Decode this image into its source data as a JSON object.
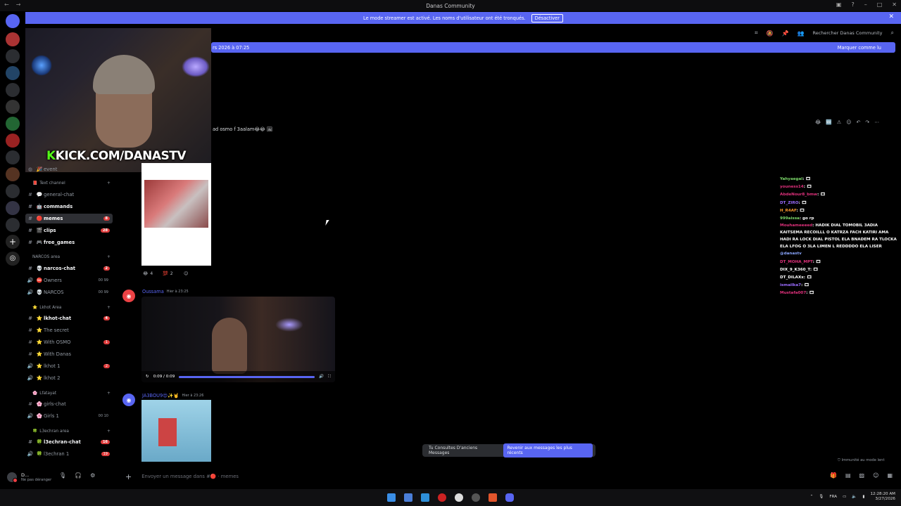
{
  "window": {
    "title": "Danas Community"
  },
  "banner": {
    "text": "Le mode streamer est activé. Les noms d'utilisateur ont été tronqués.",
    "button": "Désactiver"
  },
  "header": {
    "search_placeholder": "Rechercher Danas Community"
  },
  "new_messages_bar": {
    "date_text": "rs 2026 à 07:25",
    "mark_read": "Marquer comme lu"
  },
  "stream_overlay": {
    "kick_text": "KICK.COM/DANASTV"
  },
  "sidebar": {
    "event_item": "event",
    "categories": [
      {
        "label": "Text channel"
      },
      {
        "label": "NARCOS area"
      },
      {
        "label": "Lkhot Area"
      },
      {
        "label": "Lfatayat"
      },
      {
        "label": "L3echran area"
      }
    ],
    "channels": [
      {
        "name": "general-chat"
      },
      {
        "name": "commands"
      },
      {
        "name": "memes",
        "count": "8"
      },
      {
        "name": "clips",
        "count": "28"
      },
      {
        "name": "free_games"
      },
      {
        "name": "narcos-chat",
        "count": "2"
      },
      {
        "name": "Owners",
        "voice": "00  99"
      },
      {
        "name": "NARCOS",
        "voice": "00  99"
      },
      {
        "name": "lkhot-chat",
        "count": "4"
      },
      {
        "name": "The secret"
      },
      {
        "name": "With OSMO",
        "count": "1"
      },
      {
        "name": "With Danas"
      },
      {
        "name": "lkhot 1",
        "count": "2"
      },
      {
        "name": "lkhot 2"
      },
      {
        "name": "girls-chat"
      },
      {
        "name": "Girls 1",
        "voice": "00  10"
      },
      {
        "name": "l3echran-chat",
        "count": "16"
      },
      {
        "name": "l3echran 1",
        "count": "19"
      }
    ]
  },
  "user_panel": {
    "name": "D...",
    "status": "Ne pas déranger"
  },
  "messages": {
    "first_text": "ad osmo f 3aalam😂😂 🖼",
    "reactions": [
      {
        "emoji": "😂",
        "count": "4"
      },
      {
        "emoji": "💯",
        "count": "2"
      }
    ],
    "second_author": "Oussama",
    "second_time": "Hier à 23:25",
    "video": {
      "time": "0:09 / 0:09",
      "progress": 1.0
    },
    "third_author": "JA3BOU9😍✨🤘",
    "third_time": "Hier à 23:26"
  },
  "stream_chat": [
    {
      "user": "Yahyaegal",
      "text": ": 🎞",
      "color": "#7cd86a"
    },
    {
      "user": "youness14",
      "text": ": 🎞",
      "color": "#e0317c"
    },
    {
      "user": "AbdeNour8_bmw",
      "text": ": 🎞",
      "color": "#e0317c"
    },
    {
      "user": "DT_ZIRO",
      "text": ": 🎞",
      "color": "#9b6cff"
    },
    {
      "user": "H_R4AF",
      "text": ": 🎞",
      "color": "#ff9b2e"
    },
    {
      "user": "999aissa",
      "text": ": go rp",
      "color": "#7cd86a"
    },
    {
      "user": "Mouhameeeed",
      "text": ": HADIK DIAL TOMOBIL 3ADIA KAITSEMA RECOILLL O KATRZA FACH KATIRI AMA HADI RA LOCK DIAL PISTOL ELA BNADEM RA TLOCKA ELA LFOG O 3LA LIMEN L REDDDDO ELA LISER",
      "color": "#e0317c"
    },
    {
      "user": "@danastv",
      "text": "",
      "color": "#8aa6ff"
    },
    {
      "user": "DT_MOHA_MPT",
      "text": ": 🎞",
      "color": "#e0317c"
    },
    {
      "user": "DIX_9_K360_T",
      "text": ": 🎞",
      "color": "#ffffff"
    },
    {
      "user": "DT_DILAXx",
      "text": ": 🎞",
      "color": "#ffffff"
    },
    {
      "user": "ismailka7",
      "text": ": 🎞",
      "color": "#9b6cff"
    },
    {
      "user": "Mustafa007",
      "text": ": 🎞",
      "color": "#e0317c"
    }
  ],
  "jump_bar": {
    "text": "Tu Consultes D'anciens Messages",
    "button": "Revenir aux messages les plus récents"
  },
  "immunity_text": "Immunité au mode lent",
  "composer": {
    "placeholder": "Envoyer un message dans #🔴 · memes"
  },
  "taskbar": {
    "lang": "FRA",
    "time": "12:28:20 AM",
    "date": "3/27/2026"
  }
}
